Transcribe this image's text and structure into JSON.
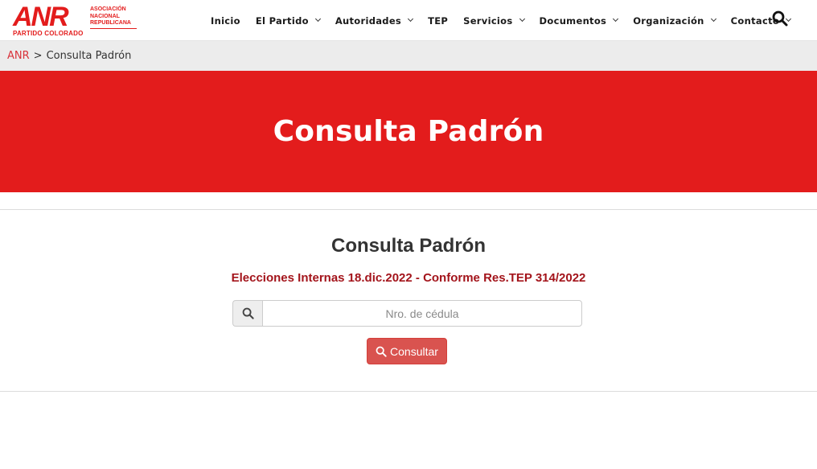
{
  "header": {
    "logo": {
      "mark": "ANR",
      "lines": [
        "ASOCIACIÓN",
        "NACIONAL",
        "REPUBLICANA"
      ],
      "tagline": "PARTIDO COLORADO"
    },
    "nav": [
      {
        "label": "Inicio",
        "dropdown": false
      },
      {
        "label": "El Partido",
        "dropdown": true
      },
      {
        "label": "Autoridades",
        "dropdown": true
      },
      {
        "label": "TEP",
        "dropdown": false
      },
      {
        "label": "Servicios",
        "dropdown": true
      },
      {
        "label": "Documentos",
        "dropdown": true
      },
      {
        "label": "Organización",
        "dropdown": true
      },
      {
        "label": "Contacto",
        "dropdown": true
      }
    ],
    "search_icon": "search-icon"
  },
  "breadcrumb": {
    "home": "ANR",
    "separator": ">",
    "current": "Consulta Padrón"
  },
  "hero": {
    "title": "Consulta Padrón"
  },
  "form": {
    "title": "Consulta Padrón",
    "subtitle": "Elecciones Internas 18.dic.2022 - Conforme Res.TEP 314/2022",
    "input_placeholder": "Nro. de cédula",
    "input_value": "",
    "button_label": "Consultar"
  },
  "colors": {
    "brand_red": "#e31c1c",
    "subtitle_red": "#a3141b",
    "button_red": "#d9534f",
    "breadcrumb_bg": "#ececec"
  }
}
